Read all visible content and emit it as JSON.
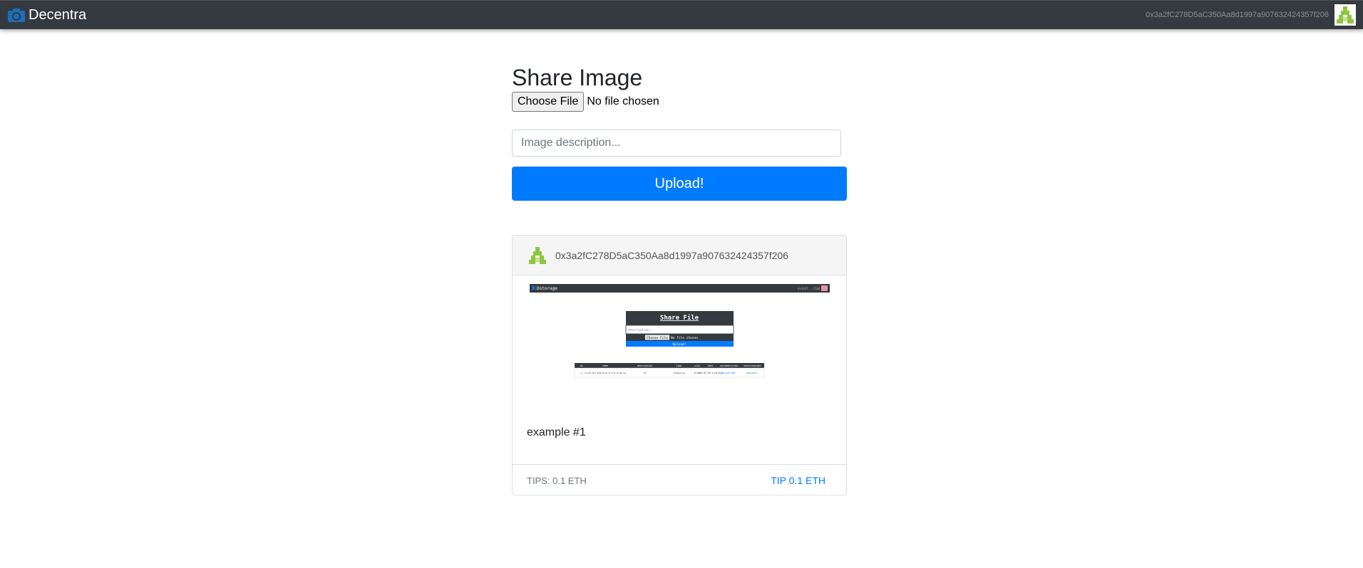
{
  "navbar": {
    "brand": "Decentra",
    "account": "0x3a2fC278D5aC350Aa8d1997a907632424357f206",
    "brand_color": "#1d6fb8",
    "bg_color": "#343a40"
  },
  "main": {
    "title": "Share Image",
    "file_button_label": "Choose File",
    "file_status": "No file chosen",
    "description_placeholder": "Image description...",
    "upload_label": "Upload!",
    "accent_color": "#007bff"
  },
  "post": {
    "author": "0x3a2fC278D5aC350Aa8d1997a907632424357f206",
    "caption": "example #1",
    "tips_text": "TIPS: 0.1 ETH",
    "tip_link": "TIP 0.1 ETH",
    "thumbnail": {
      "brand": "Dstorage",
      "title": "Share File",
      "desc_placeholder": "description...",
      "choose_label": "Choose File",
      "no_file": "No file chosen",
      "upload_label": "Upload!",
      "headers": [
        "id",
        "name",
        "description",
        "type",
        "size",
        "date",
        "uploader/view",
        "hash/view/get"
      ],
      "row": [
        "1",
        "Screen Shot 2021-02-03 at 9.03.10 PM.png",
        "ok",
        "image/png",
        "43 KB",
        "6:12:49 PM 2/18/2021",
        "0x3a2fC7Bb…",
        "QmXwfbm7…"
      ]
    }
  }
}
